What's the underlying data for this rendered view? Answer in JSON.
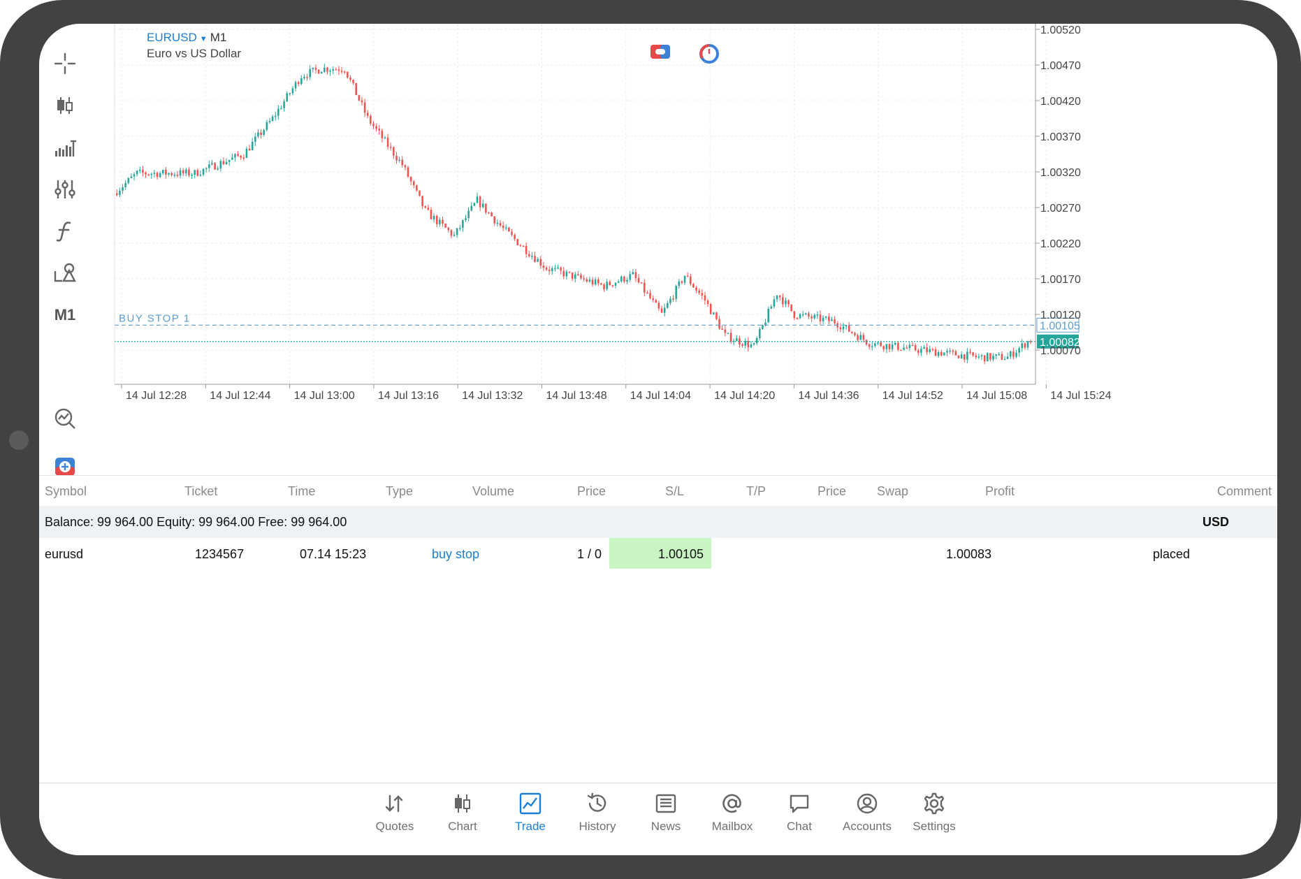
{
  "chart": {
    "symbol": "EURUSD",
    "timeframe": "M1",
    "description": "Euro vs US Dollar",
    "order_line_label": "BUY STOP 1",
    "price_levels": [
      "1.00520",
      "1.00470",
      "1.00420",
      "1.00370",
      "1.00320",
      "1.00270",
      "1.00220",
      "1.00170",
      "1.00120",
      "1.00070"
    ],
    "buy_stop_price": "1.00105",
    "current_price": "1.00082",
    "time_labels": [
      "14 Jul 12:28",
      "14 Jul 12:44",
      "14 Jul 13:00",
      "14 Jul 13:16",
      "14 Jul 13:32",
      "14 Jul 13:48",
      "14 Jul 14:04",
      "14 Jul 14:20",
      "14 Jul 14:36",
      "14 Jul 14:52",
      "14 Jul 15:08",
      "14 Jul 15:24"
    ],
    "colors": {
      "bull": "#26a69a",
      "bear": "#ef5350",
      "order_line": "#5a9fd4",
      "price_line": "#26a69a"
    }
  },
  "toolbar": {
    "timeframe_label": "M1",
    "icons": [
      "crosshair-icon",
      "chart-type-icon",
      "indicators-icon",
      "indicator-settings-icon",
      "function-icon",
      "objects-icon",
      "trade-signal-icon",
      "one-click-trade-icon"
    ]
  },
  "table": {
    "headers": [
      "Symbol",
      "Ticket",
      "Time",
      "Type",
      "Volume",
      "Price",
      "S/L",
      "T/P",
      "Price",
      "Swap",
      "Profit",
      "Comment"
    ],
    "balance_summary": "Balance: 99 964.00 Equity: 99 964.00 Free: 99 964.00",
    "currency": "USD",
    "order": {
      "symbol": "eurusd",
      "ticket": "1234567",
      "time": "07.14 15:23",
      "type": "buy stop",
      "volume": "1 / 0",
      "price": "1.00105",
      "current_price": "1.00083",
      "status": "placed"
    }
  },
  "tabs": [
    {
      "label": "Quotes",
      "icon": "quotes-icon"
    },
    {
      "label": "Chart",
      "icon": "chart-icon"
    },
    {
      "label": "Trade",
      "icon": "trade-icon",
      "active": true
    },
    {
      "label": "History",
      "icon": "history-icon"
    },
    {
      "label": "News",
      "icon": "news-icon"
    },
    {
      "label": "Mailbox",
      "icon": "mailbox-icon"
    },
    {
      "label": "Chat",
      "icon": "chat-icon"
    },
    {
      "label": "Accounts",
      "icon": "accounts-icon"
    },
    {
      "label": "Settings",
      "icon": "settings-icon"
    }
  ]
}
